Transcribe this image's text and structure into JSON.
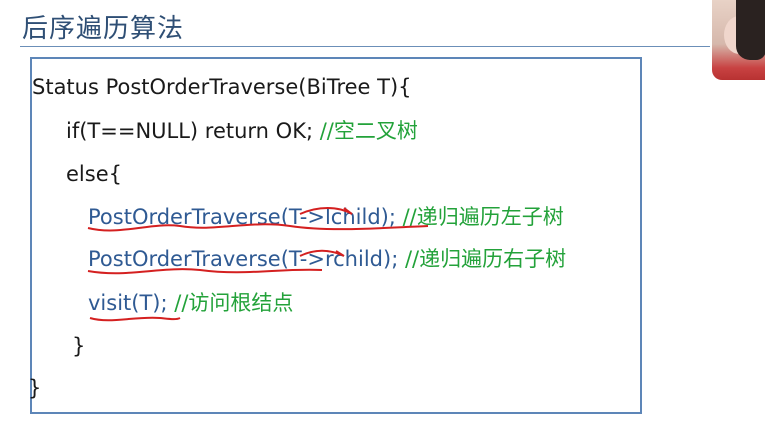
{
  "slide": {
    "title": "后序遍历算法"
  },
  "code": {
    "lines": [
      {
        "text": "Status PostOrderTraverse(BiTree T){",
        "comment": ""
      },
      {
        "text": "if(T==NULL) return OK; ",
        "comment": "//空二叉树"
      },
      {
        "text": "else{",
        "comment": ""
      },
      {
        "text": "PostOrderTraverse(T->lchild); ",
        "comment": "//递归遍历左子树"
      },
      {
        "text": "PostOrderTraverse(T->rchild); ",
        "comment": "//递归遍历右子树"
      },
      {
        "text": "visit(T);  ",
        "comment": "//访问根结点"
      },
      {
        "text": "}",
        "comment": ""
      },
      {
        "text": "}",
        "comment": ""
      }
    ]
  },
  "colors": {
    "title": "#2f4f75",
    "frame": "#5d86b8",
    "comment": "#23a23a",
    "annotation": "#d42020"
  }
}
